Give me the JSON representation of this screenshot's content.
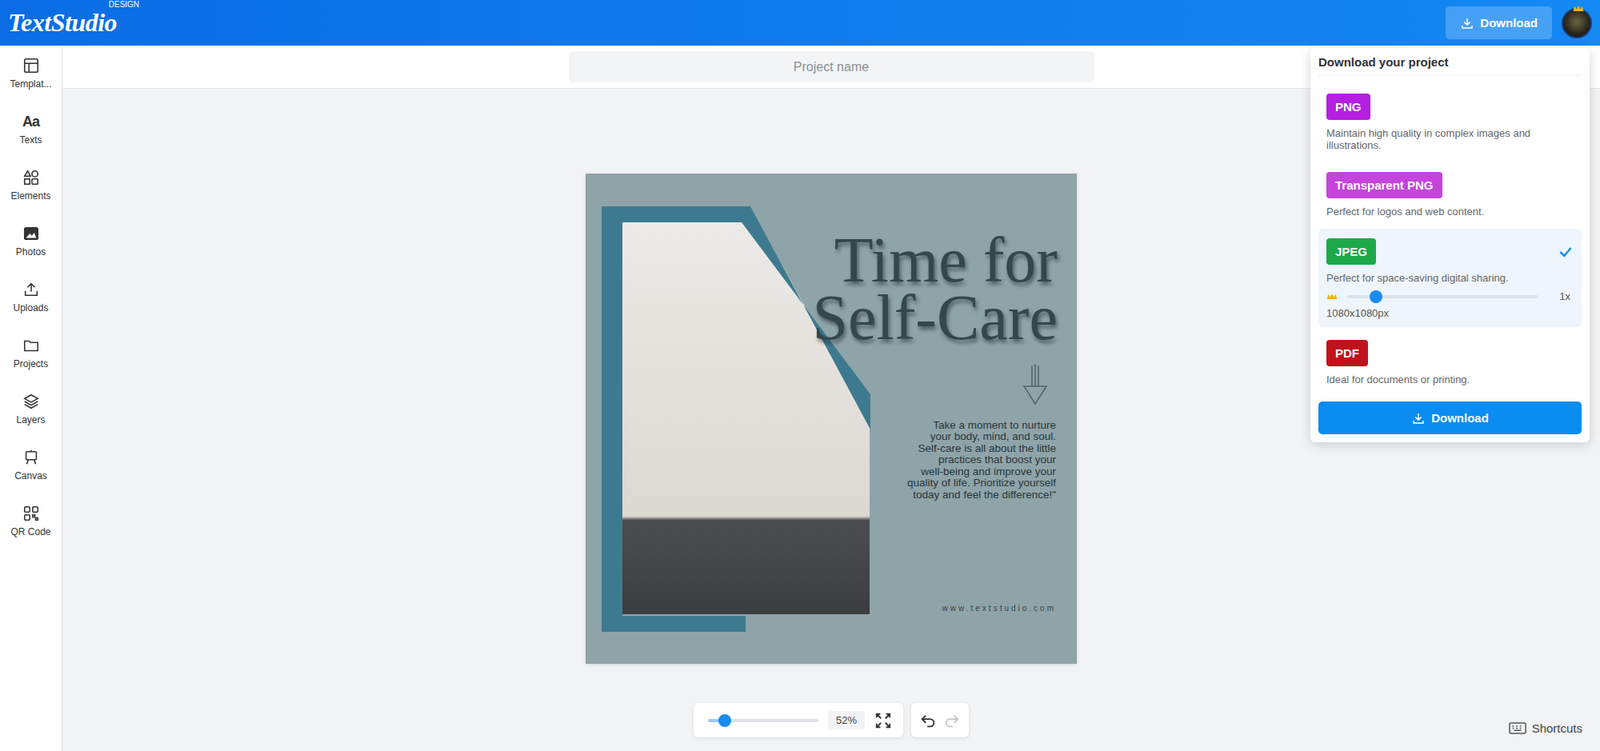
{
  "app": {
    "logo": "TextStudio",
    "logo_badge": "DESIGN",
    "download_button": "Download"
  },
  "sidebar": {
    "items": [
      {
        "label": "Templat..."
      },
      {
        "label": "Texts",
        "glyph": "Aa"
      },
      {
        "label": "Elements"
      },
      {
        "label": "Photos"
      },
      {
        "label": "Uploads"
      },
      {
        "label": "Projects"
      },
      {
        "label": "Layers"
      },
      {
        "label": "Canvas"
      },
      {
        "label": "QR Code"
      }
    ]
  },
  "project": {
    "placeholder": "Project name"
  },
  "design": {
    "headline": [
      "Time for",
      "Self-Care"
    ],
    "body": [
      "Take a moment to nurture",
      "your body, mind, and soul.",
      "Self-care is all about the little",
      "practices that boost your",
      "well-being and improve your",
      "quality of life. Prioritize yourself",
      "today and feel the difference!\""
    ],
    "website": "www.textstudio.com"
  },
  "zoom": {
    "level": 0.15,
    "reading": "52%"
  },
  "history": [
    {
      "kind": "undo",
      "disabled": false
    },
    {
      "kind": "redo",
      "disabled": true
    }
  ],
  "shortcuts": "Shortcuts",
  "download_menu": {
    "title": "Download your project",
    "options": [
      {
        "label": "PNG",
        "description": "Maintain high quality in complex images and illustrations.",
        "color": "#b41fe0",
        "selected": false
      },
      {
        "label": "Transparent PNG",
        "description": "Perfect for logos and web content.",
        "color": "#c544dc",
        "selected": false
      },
      {
        "label": "JPEG",
        "description": "Perfect for space-saving digital sharing.",
        "color": "#1ea84a",
        "selected": true,
        "scale": {
          "level": 0.15,
          "reading": "1x",
          "size": "1080x1080px"
        }
      },
      {
        "label": "PDF",
        "description": "Ideal for documents or printing.",
        "color": "#c0121c",
        "selected": false
      }
    ],
    "button": "Download"
  }
}
